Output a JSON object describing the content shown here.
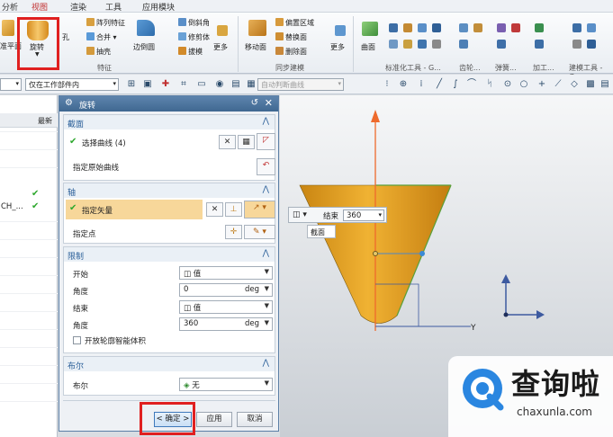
{
  "menubar": {
    "items": [
      "分析",
      "视图",
      "渲染",
      "工具",
      "应用模块"
    ]
  },
  "ribbon": {
    "datum_plane_label": "准平面",
    "rotate_label": "旋转",
    "hole_label": "孔",
    "pattern_feature": "阵列特征",
    "unite": "合并",
    "shell": "抽壳",
    "feature_group": "特征",
    "edge_blend": "边倒圆",
    "chamfer": "倒斜角",
    "trim_body": "修剪体",
    "draft": "拔模",
    "more1": "更多",
    "move_face": "移动面",
    "offset_region": "偏置区域",
    "replace_face": "替换面",
    "delete_face": "删除面",
    "sync_group": "同步建模",
    "more2": "更多",
    "surface": "曲面",
    "std_group": "标准化工具 - G...",
    "gear_group": "齿轮...",
    "spring_group": "弹簧...",
    "machining_group": "加工...",
    "modeling_group": "建模工具 - G..."
  },
  "selbar": {
    "filter": "",
    "scope": "仅在工作部件内",
    "snap": "自动判断曲线"
  },
  "nav": {
    "header": "最新",
    "row_text": "CH_..."
  },
  "dialog": {
    "title": "旋转",
    "section_section": {
      "header": "截面",
      "select_curve": "选择曲线 (4)",
      "specify_origin_curve": "指定原始曲线"
    },
    "section_axis": {
      "header": "轴",
      "specify_vector": "指定矢量",
      "specify_point": "指定点"
    },
    "section_limits": {
      "header": "限制",
      "start_label": "开始",
      "start_value": "值",
      "start_angle_label": "角度",
      "start_angle": "0",
      "end_label": "结束",
      "end_value": "值",
      "end_angle_label": "角度",
      "end_angle": "360",
      "unit": "deg",
      "open_profile": "开放轮廓智能体积"
    },
    "section_boolean": {
      "header": "布尔",
      "label": "布尔",
      "value": "无"
    },
    "ok": "< 确定 >",
    "apply": "应用",
    "cancel": "取消"
  },
  "graphics": {
    "float_end_label": "结束",
    "float_end_value": "360",
    "tooltip": "截面",
    "axis_y": "Y",
    "axis_x": "X"
  },
  "watermark": {
    "cn": "查询啦",
    "en": "chaxunla.com"
  },
  "colors": {
    "accent_red": "#e02020",
    "cone_orange": "#e3a11a",
    "axis_arrow": "#ee6a2c",
    "triad_blue": "#3d5aa0",
    "title_bar": "#4a739c"
  }
}
